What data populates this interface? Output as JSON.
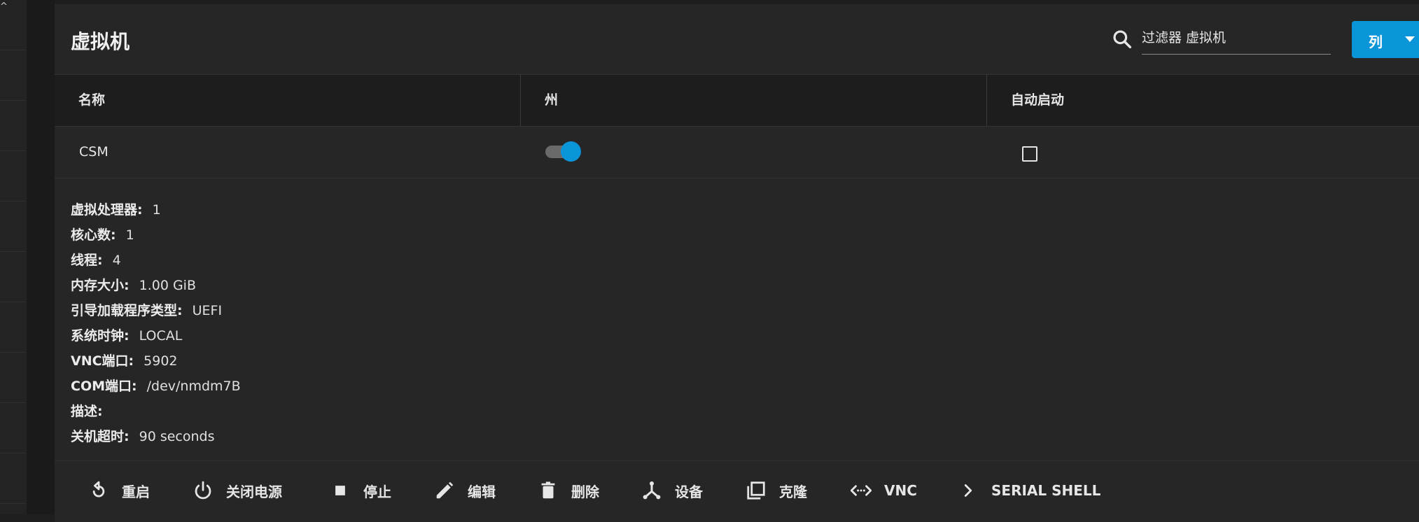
{
  "page": {
    "title": "虚拟机"
  },
  "search": {
    "placeholder": "过滤器 虚拟机",
    "icon": "search-icon"
  },
  "columns_button": {
    "label": "列"
  },
  "table": {
    "headers": [
      "名称",
      "州",
      "自动启动"
    ],
    "rows": [
      {
        "name": "CSM",
        "state_running": true,
        "autostart": false
      }
    ]
  },
  "details": [
    {
      "key": "虚拟处理器:",
      "value": "1"
    },
    {
      "key": "核心数:",
      "value": "1"
    },
    {
      "key": "线程:",
      "value": "4"
    },
    {
      "key": "内存大小:",
      "value": "1.00 GiB"
    },
    {
      "key": "引导加载程序类型:",
      "value": "UEFI"
    },
    {
      "key": "系统时钟:",
      "value": "LOCAL"
    },
    {
      "key": "VNC端口:",
      "value": "5902"
    },
    {
      "key": "COM端口:",
      "value": "/dev/nmdm7B"
    },
    {
      "key": "描述:",
      "value": ""
    },
    {
      "key": "关机超时:",
      "value": "90 seconds"
    }
  ],
  "actions": [
    {
      "label": "重启",
      "icon": "restart-icon"
    },
    {
      "label": "关闭电源",
      "icon": "power-icon"
    },
    {
      "label": "停止",
      "icon": "stop-icon"
    },
    {
      "label": "编辑",
      "icon": "pencil-icon"
    },
    {
      "label": "删除",
      "icon": "trash-icon"
    },
    {
      "label": "设备",
      "icon": "devices-icon"
    },
    {
      "label": "克隆",
      "icon": "clone-icon"
    },
    {
      "label": "VNC",
      "icon": "vnc-icon"
    },
    {
      "label": "SERIAL SHELL",
      "icon": "chevron-right-icon"
    }
  ],
  "colors": {
    "accent": "#0a95d8",
    "card": "#262626",
    "background": "#1e1e1e"
  }
}
